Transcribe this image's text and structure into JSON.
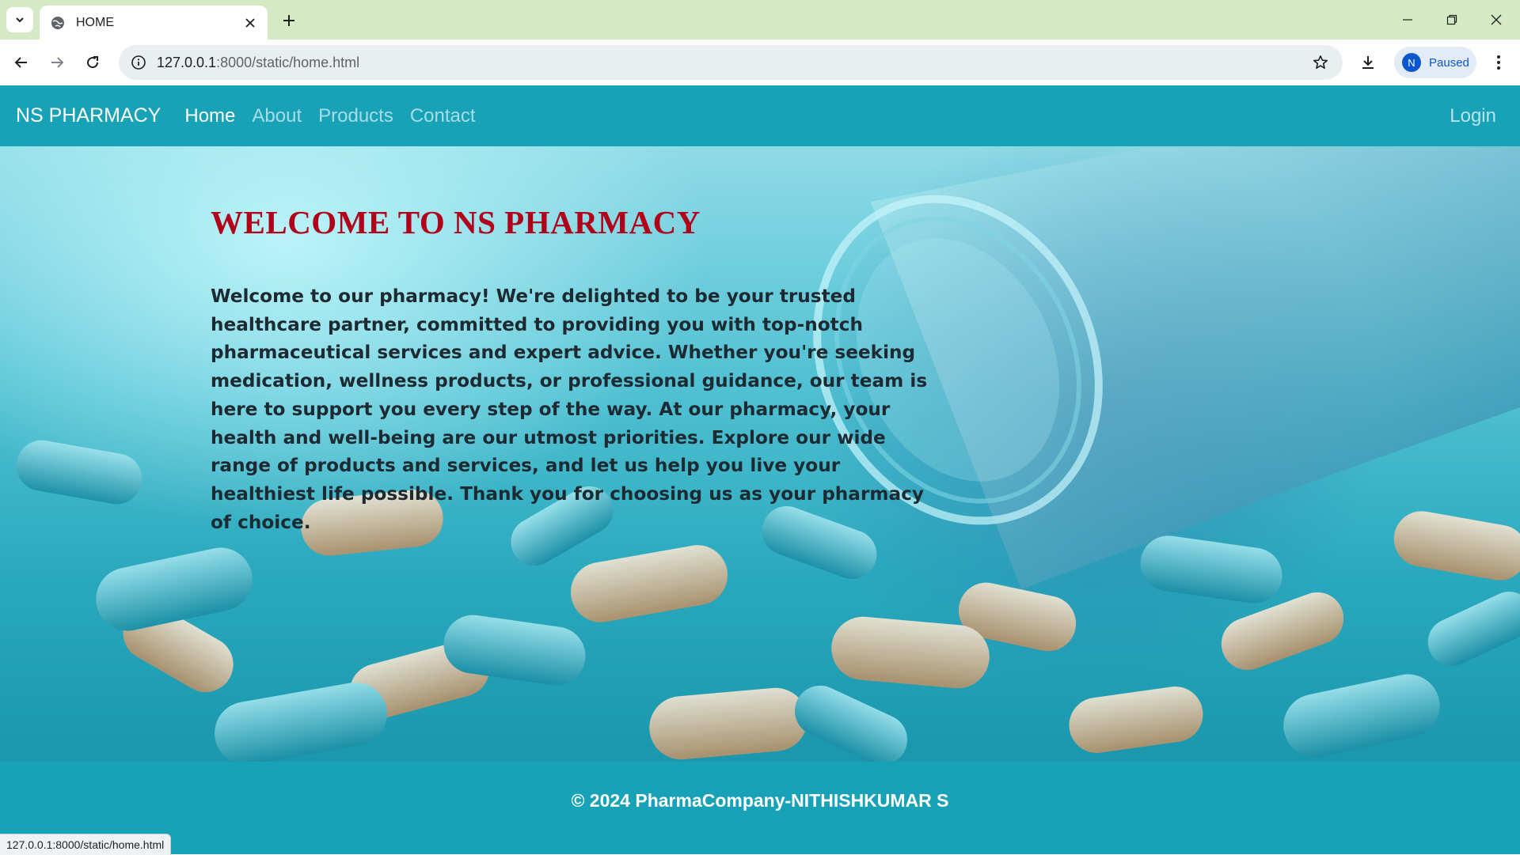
{
  "browser": {
    "tab_title": "HOME",
    "url_host": "127.0.0.1",
    "url_rest": ":8000/static/home.html",
    "profile_initial": "N",
    "profile_status": "Paused",
    "status_url": "127.0.0.1:8000/static/home.html",
    "icons": [
      "tab-search-icon",
      "globe-icon",
      "close-icon",
      "plus-icon",
      "minimize-icon",
      "restore-icon",
      "window-close-icon",
      "back-icon",
      "forward-icon",
      "reload-icon",
      "info-icon",
      "star-icon",
      "download-icon",
      "kebab-menu-icon"
    ]
  },
  "site": {
    "brand": "NS PHARMACY",
    "nav": [
      {
        "label": "Home",
        "active": true
      },
      {
        "label": "About",
        "active": false
      },
      {
        "label": "Products",
        "active": false
      },
      {
        "label": "Contact",
        "active": false
      }
    ],
    "login": "Login"
  },
  "hero": {
    "title": "WELCOME TO NS PHARMACY",
    "text": "Welcome to our pharmacy! We're delighted to be your trusted healthcare partner, committed to providing you with top-notch pharmaceutical services and expert advice. Whether you're seeking medication, wellness products, or professional guidance, our team is here to support you every step of the way. At our pharmacy, your health and well-being are our utmost priorities. Explore our wide range of products and services, and let us help you live your healthiest life possible. Thank you for choosing us as your pharmacy of choice."
  },
  "footer": {
    "copyright": "© 2024 PharmaCompany-NITHISHKUMAR S"
  },
  "colors": {
    "nav_bg": "#17a2b8",
    "title_red": "#b0001a",
    "tabstrip_bg": "#d3eac4"
  }
}
